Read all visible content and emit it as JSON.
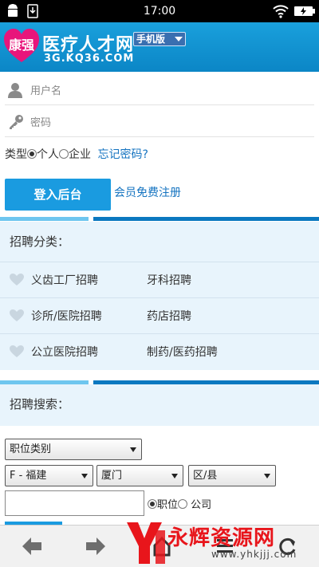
{
  "status_bar": {
    "time": "17:00"
  },
  "header": {
    "logo_badge": "康强",
    "site_name": "医疗人才网",
    "domain": "3G.KQ36.COM",
    "mobile_label": "手机版"
  },
  "login": {
    "username_placeholder": "用户名",
    "password_placeholder": "密码",
    "type_label": "类型",
    "option_personal": "个人",
    "option_company": "企业",
    "forgot_password": "忘记密码?",
    "login_button": "登入后台",
    "register_link": "会员免费注册"
  },
  "categories": {
    "title": "招聘分类：",
    "rows": [
      {
        "left": "义齿工厂招聘",
        "right": "牙科招聘"
      },
      {
        "left": "诊所/医院招聘",
        "right": "药店招聘"
      },
      {
        "left": "公立医院招聘",
        "right": "制药/医药招聘"
      }
    ]
  },
  "search": {
    "title": "招聘搜索：",
    "job_category": "职位类别",
    "province": "F - 福建",
    "city": "厦门",
    "district": "区/县",
    "option_position": "职位",
    "option_company": "公司"
  },
  "watermark": {
    "text": "永辉资源网",
    "url": "www.yhkjjj.com"
  },
  "colors": {
    "brand_blue": "#1a9be0",
    "header_blue": "#0b86c6",
    "link_blue": "#1473c0",
    "panel_bg": "#e8f4fc"
  }
}
